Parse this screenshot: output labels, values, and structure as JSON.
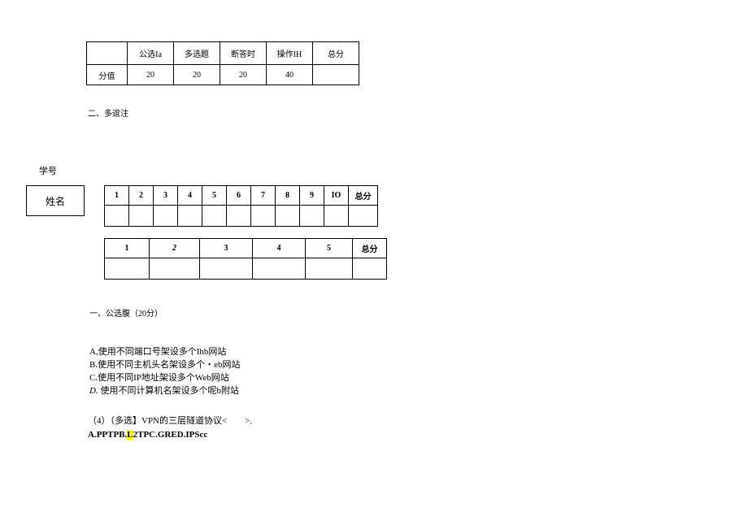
{
  "score_table": {
    "headers": [
      "",
      "公选Ia",
      "多选题",
      "断答时",
      "操作IH",
      "总分"
    ],
    "row_label": "分值",
    "values": [
      "20",
      "20",
      "20",
      "40",
      ""
    ]
  },
  "section2_label": "二、多逡注",
  "student_id_label": "学号",
  "name_label": "姓名",
  "answer_table1": {
    "headers": [
      "1",
      "2",
      "3",
      "4",
      "5",
      "6",
      "7",
      "8",
      "9",
      "IO",
      "总分"
    ]
  },
  "answer_table2": {
    "headers": [
      "1",
      "2",
      "3",
      "4",
      "5",
      "总分"
    ]
  },
  "section1_label": "一、公选腹（20分）",
  "options": {
    "a": "A,使用不同端口号架设多个Ihb网站",
    "b": "B.使用不同主机头名架设多个・eb网站",
    "c": "C.使用不同IP地址架设多个Web网站",
    "d_prefix": "D.",
    "d_text": " 使用不同计算机名架设多个呢b附站"
  },
  "q4": {
    "line1": "（4）（多选】VPN的三层隧道协议<　　>.",
    "line2_prefix": "A.PPTPB.",
    "line2_hl": "L",
    "line2_suffix": "2TPC.GRED.IPScc"
  }
}
